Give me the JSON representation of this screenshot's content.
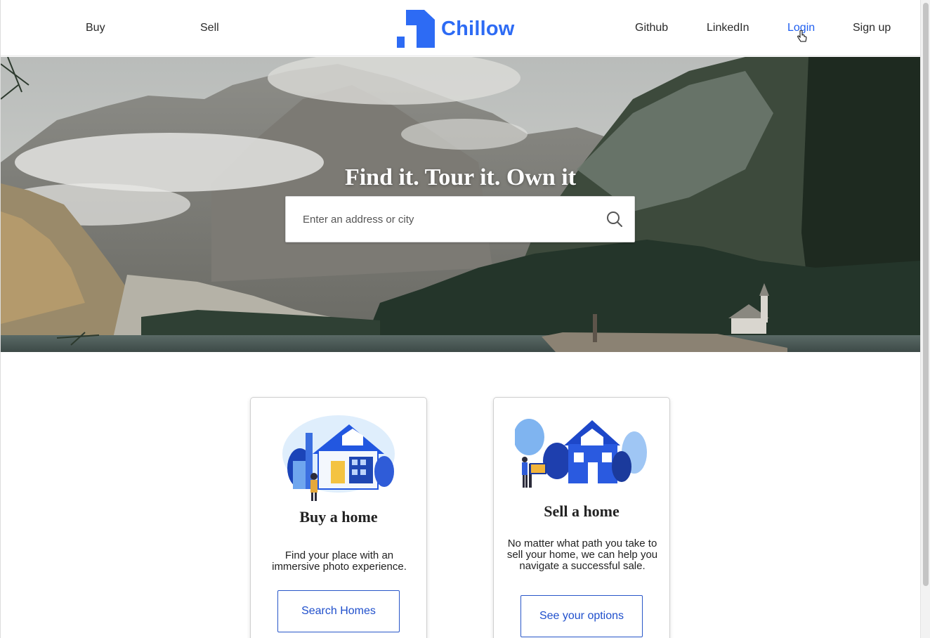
{
  "nav": {
    "buy": "Buy",
    "sell": "Sell",
    "github": "Github",
    "linkedin": "LinkedIn",
    "login": "Login",
    "signup": "Sign up"
  },
  "brand": {
    "name": "Chillow",
    "color": "#2d6bf4"
  },
  "hero": {
    "title": "Find it. Tour it. Own it",
    "search_placeholder": "Enter an address or city",
    "search_icon": "magnifier-icon"
  },
  "cards": {
    "buy": {
      "title": "Buy a home",
      "text": "Find your place with an immersive photo experience.",
      "button": "Search Homes"
    },
    "sell": {
      "title": "Sell a home",
      "text": "No matter what path you take to sell your home, we can help you navigate a successful sale.",
      "button": "See your options"
    }
  },
  "colors": {
    "accent": "#1f5ff0",
    "button_border": "#2856c8"
  }
}
